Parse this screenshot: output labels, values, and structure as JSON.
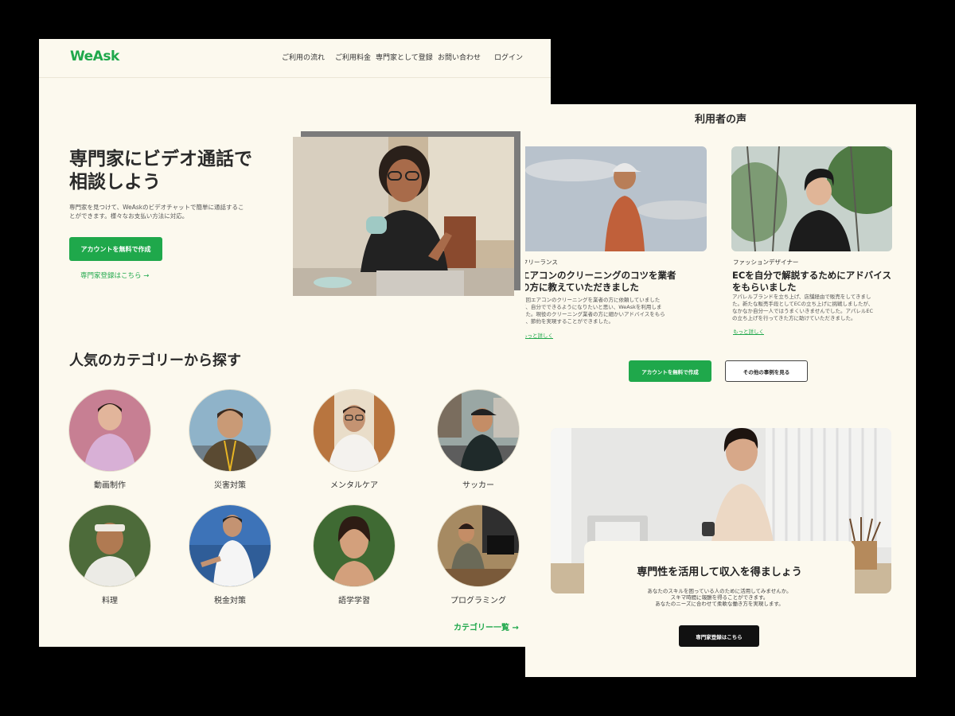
{
  "brand": {
    "logo": "WeAsk",
    "accent": "#1fa84b",
    "background": "#fcf9ee"
  },
  "nav": [
    "ご利用の流れ",
    "ご利用料金",
    "専門家として登録",
    "お問い合わせ",
    "ログイン"
  ],
  "hero": {
    "title_line1": "専門家にビデオ通話で",
    "title_line2": "相談しよう",
    "subtitle_line1": "専門家を見つけて、WeAskのビデオチャットで簡単に通話するこ",
    "subtitle_line2": "とができます。様々なお支払い方法に対応。",
    "cta": "アカウントを無料で作成",
    "expert_link": "専門家登録はこちら →"
  },
  "categories": {
    "title": "人気のカテゴリーから探す",
    "items": [
      {
        "label": "動画制作",
        "icon": "person-portrait"
      },
      {
        "label": "災害対策",
        "icon": "person-portrait"
      },
      {
        "label": "メンタルケア",
        "icon": "person-portrait"
      },
      {
        "label": "サッカー",
        "icon": "person-portrait"
      },
      {
        "label": "料理",
        "icon": "person-portrait"
      },
      {
        "label": "税金対策",
        "icon": "person-portrait"
      },
      {
        "label": "語学学習",
        "icon": "person-portrait"
      },
      {
        "label": "プログラミング",
        "icon": "person-portrait"
      }
    ],
    "all_link": "カテゴリー一覧 →"
  },
  "testimonials": {
    "title": "利用者の声",
    "cards": [
      {
        "role": "フリーランス",
        "title_line1": "エアコンのクリーニングのコツを業者",
        "title_line2": "の方に教えていただきました",
        "text_line1": "前回エアコンのクリーニングを業者の方に依頼していました",
        "text_line2": "が、自分でできるようになりたいと思い、WeAskを利用しま",
        "text_line3": "した。現役のクリーニング業者の方に細かいアドバイスをもら",
        "text_line4": "い、節約を実現することができました。",
        "link": "もっと詳しく"
      },
      {
        "role": "ファッションデザイナー",
        "title_line1": "ECを自分で解説するためにアドバイス",
        "title_line2": "をもらいました",
        "text_line1": "アパレルブランドを立ち上げ、店舗経由で販売をしてきまし",
        "text_line2": "た。新たな販売手段としてECの立ち上げに挑戦しましたが、",
        "text_line3": "なかなか自分一人ではうまくいきませんでした。アパレルEC",
        "text_line4": "の立ち上げを行ってきた方に助けていただきました。",
        "link": "もっと詳しく"
      }
    ],
    "cta_primary": "アカウントを無料で作成",
    "cta_secondary": "その他の事例を見る"
  },
  "earn": {
    "title": "専門性を活用して収入を得ましょう",
    "text_line1": "あなたのスキルを困っている人のために活用してみませんか。",
    "text_line2": "スキマ時間に報酬を得ることができます。",
    "text_line3": "あなたのニーズに合わせて柔軟な働き方を実現します。",
    "cta": "専門家登録はこちら"
  }
}
